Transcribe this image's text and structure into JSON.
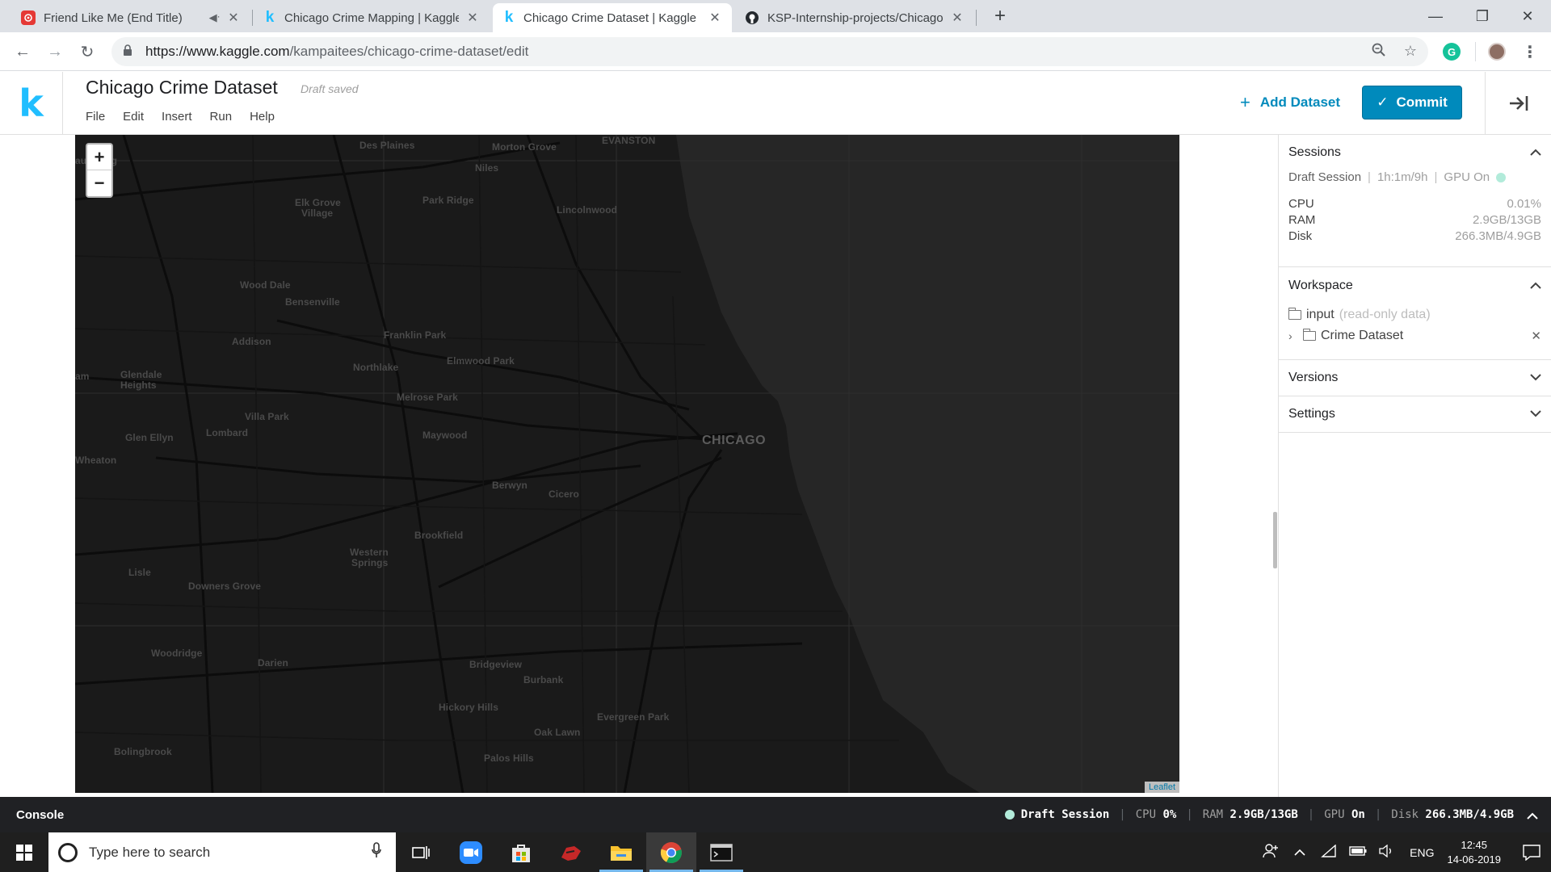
{
  "browser": {
    "tabs": [
      {
        "title": "Friend Like Me (End Title)",
        "favicon": "audio-app-icon"
      },
      {
        "title": "Chicago Crime Mapping | Kaggle",
        "favicon": "kaggle-icon"
      },
      {
        "title": "Chicago Crime Dataset | Kaggle",
        "favicon": "kaggle-icon"
      },
      {
        "title": "KSP-Internship-projects/Chicago",
        "favicon": "github-icon"
      }
    ],
    "url_host": "https://www.kaggle.com",
    "url_path": "/kampaitees/chicago-crime-dataset/edit"
  },
  "kaggle": {
    "logo": "k",
    "title": "Chicago Crime Dataset",
    "status": "Draft saved",
    "menu": [
      "File",
      "Edit",
      "Insert",
      "Run",
      "Help"
    ],
    "add_dataset": "Add Dataset",
    "commit": "Commit",
    "accent_color": "#008abc"
  },
  "map": {
    "zoom_in": "+",
    "zoom_out": "−",
    "attribution": "Leaflet",
    "labels": {
      "evanston": "EVANSTON",
      "des_plaines": "Des Plaines",
      "morton_grove": "Morton Grove",
      "schaumburg": "aumburg",
      "niles": "Niles",
      "elk_grove": "Elk Grove",
      "elk_grove_2": "Village",
      "park_ridge": "Park Ridge",
      "lincolnwood": "Lincolnwood",
      "wood_dale": "Wood Dale",
      "bensenville": "Bensenville",
      "franklin_park": "Franklin Park",
      "addison": "Addison",
      "northlake": "Northlake",
      "elmwood_park": "Elmwood Park",
      "glendale": "Glendale",
      "glendale_2": "Heights",
      "bloomingdale": "am",
      "melrose_park": "Melrose Park",
      "villa_park": "Villa Park",
      "lombard": "Lombard",
      "glen_ellyn": "Glen Ellyn",
      "maywood": "Maywood",
      "chicago": "CHICAGO",
      "wheaton": "Wheaton",
      "berwyn": "Berwyn",
      "cicero": "Cicero",
      "brookfield": "Brookfield",
      "western_springs": "Western",
      "western_springs_2": "Springs",
      "lisle": "Lisle",
      "downers_grove": "Downers Grove",
      "woodridge": "Woodridge",
      "darien": "Darien",
      "bridgeview": "Bridgeview",
      "burbank": "Burbank",
      "hickory_hills": "Hickory Hills",
      "evergreen_park": "Evergreen Park",
      "oak_lawn": "Oak Lawn",
      "bolingbrook": "Bolingbrook",
      "palos_hills": "Palos Hills"
    }
  },
  "panel": {
    "sessions": {
      "heading": "Sessions",
      "name": "Draft Session",
      "time": "1h:1m/9h",
      "gpu": "GPU On",
      "resources": [
        {
          "label": "CPU",
          "value": "0.01%"
        },
        {
          "label": "RAM",
          "value": "2.9GB/13GB"
        },
        {
          "label": "Disk",
          "value": "266.3MB/4.9GB"
        }
      ]
    },
    "workspace": {
      "heading": "Workspace",
      "input_label": "input",
      "input_note": "(read-only data)",
      "dataset": "Crime Dataset"
    },
    "versions": {
      "heading": "Versions"
    },
    "settings": {
      "heading": "Settings"
    }
  },
  "console": {
    "label": "Console",
    "session": "Draft Session",
    "cpu_label": "CPU",
    "cpu_value": "0%",
    "ram_label": "RAM",
    "ram_value": "2.9GB/13GB",
    "gpu_label": "GPU",
    "gpu_value": "On",
    "disk_label": "Disk",
    "disk_value": "266.3MB/4.9GB"
  },
  "taskbar": {
    "search_placeholder": "Type here to search",
    "language": "ENG",
    "time": "12:45",
    "date": "14-06-2019"
  }
}
